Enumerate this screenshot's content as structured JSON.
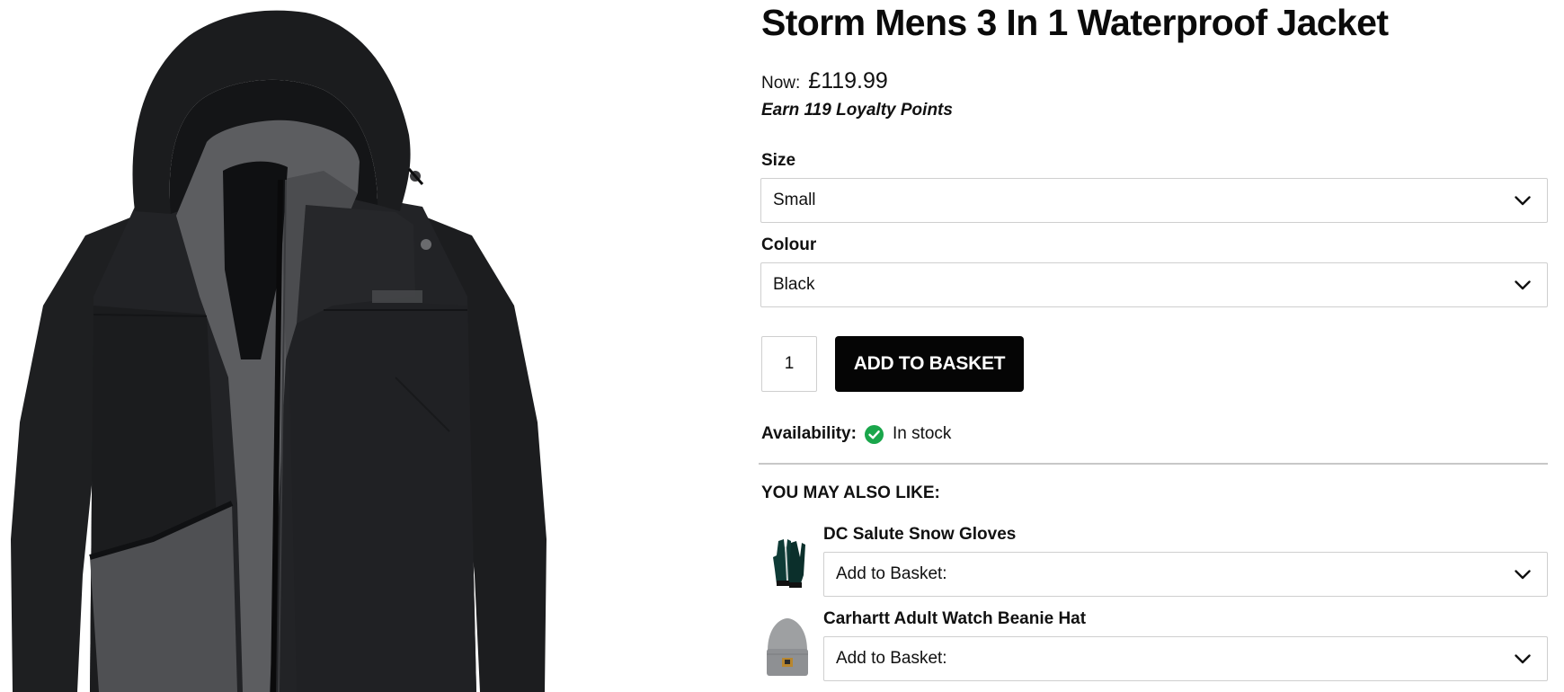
{
  "product": {
    "title": "Storm Mens 3 In 1 Waterproof Jacket",
    "image_icon": "jacket-photo",
    "price_prefix": "Now:",
    "price": "£119.99",
    "loyalty": "Earn 119 Loyalty Points"
  },
  "options": {
    "size_label": "Size",
    "size_value": "Small",
    "colour_label": "Colour",
    "colour_value": "Black"
  },
  "purchase": {
    "quantity": "1",
    "add_to_basket_label": "ADD TO BASKET"
  },
  "availability": {
    "label": "Availability:",
    "status": "In stock",
    "status_color": "#1aa64b"
  },
  "recommendations": {
    "heading": "YOU MAY ALSO LIKE:",
    "items": [
      {
        "name": "DC Salute Snow Gloves",
        "select_value": "Add to Basket:",
        "thumb_icon": "gloves-thumbnail"
      },
      {
        "name": "Carhartt Adult Watch Beanie Hat",
        "select_value": "Add to Basket:",
        "thumb_icon": "beanie-thumbnail"
      }
    ]
  },
  "colors": {
    "button_bg": "#050505",
    "border": "#cfcfcf",
    "divider": "#c8c8c8"
  }
}
